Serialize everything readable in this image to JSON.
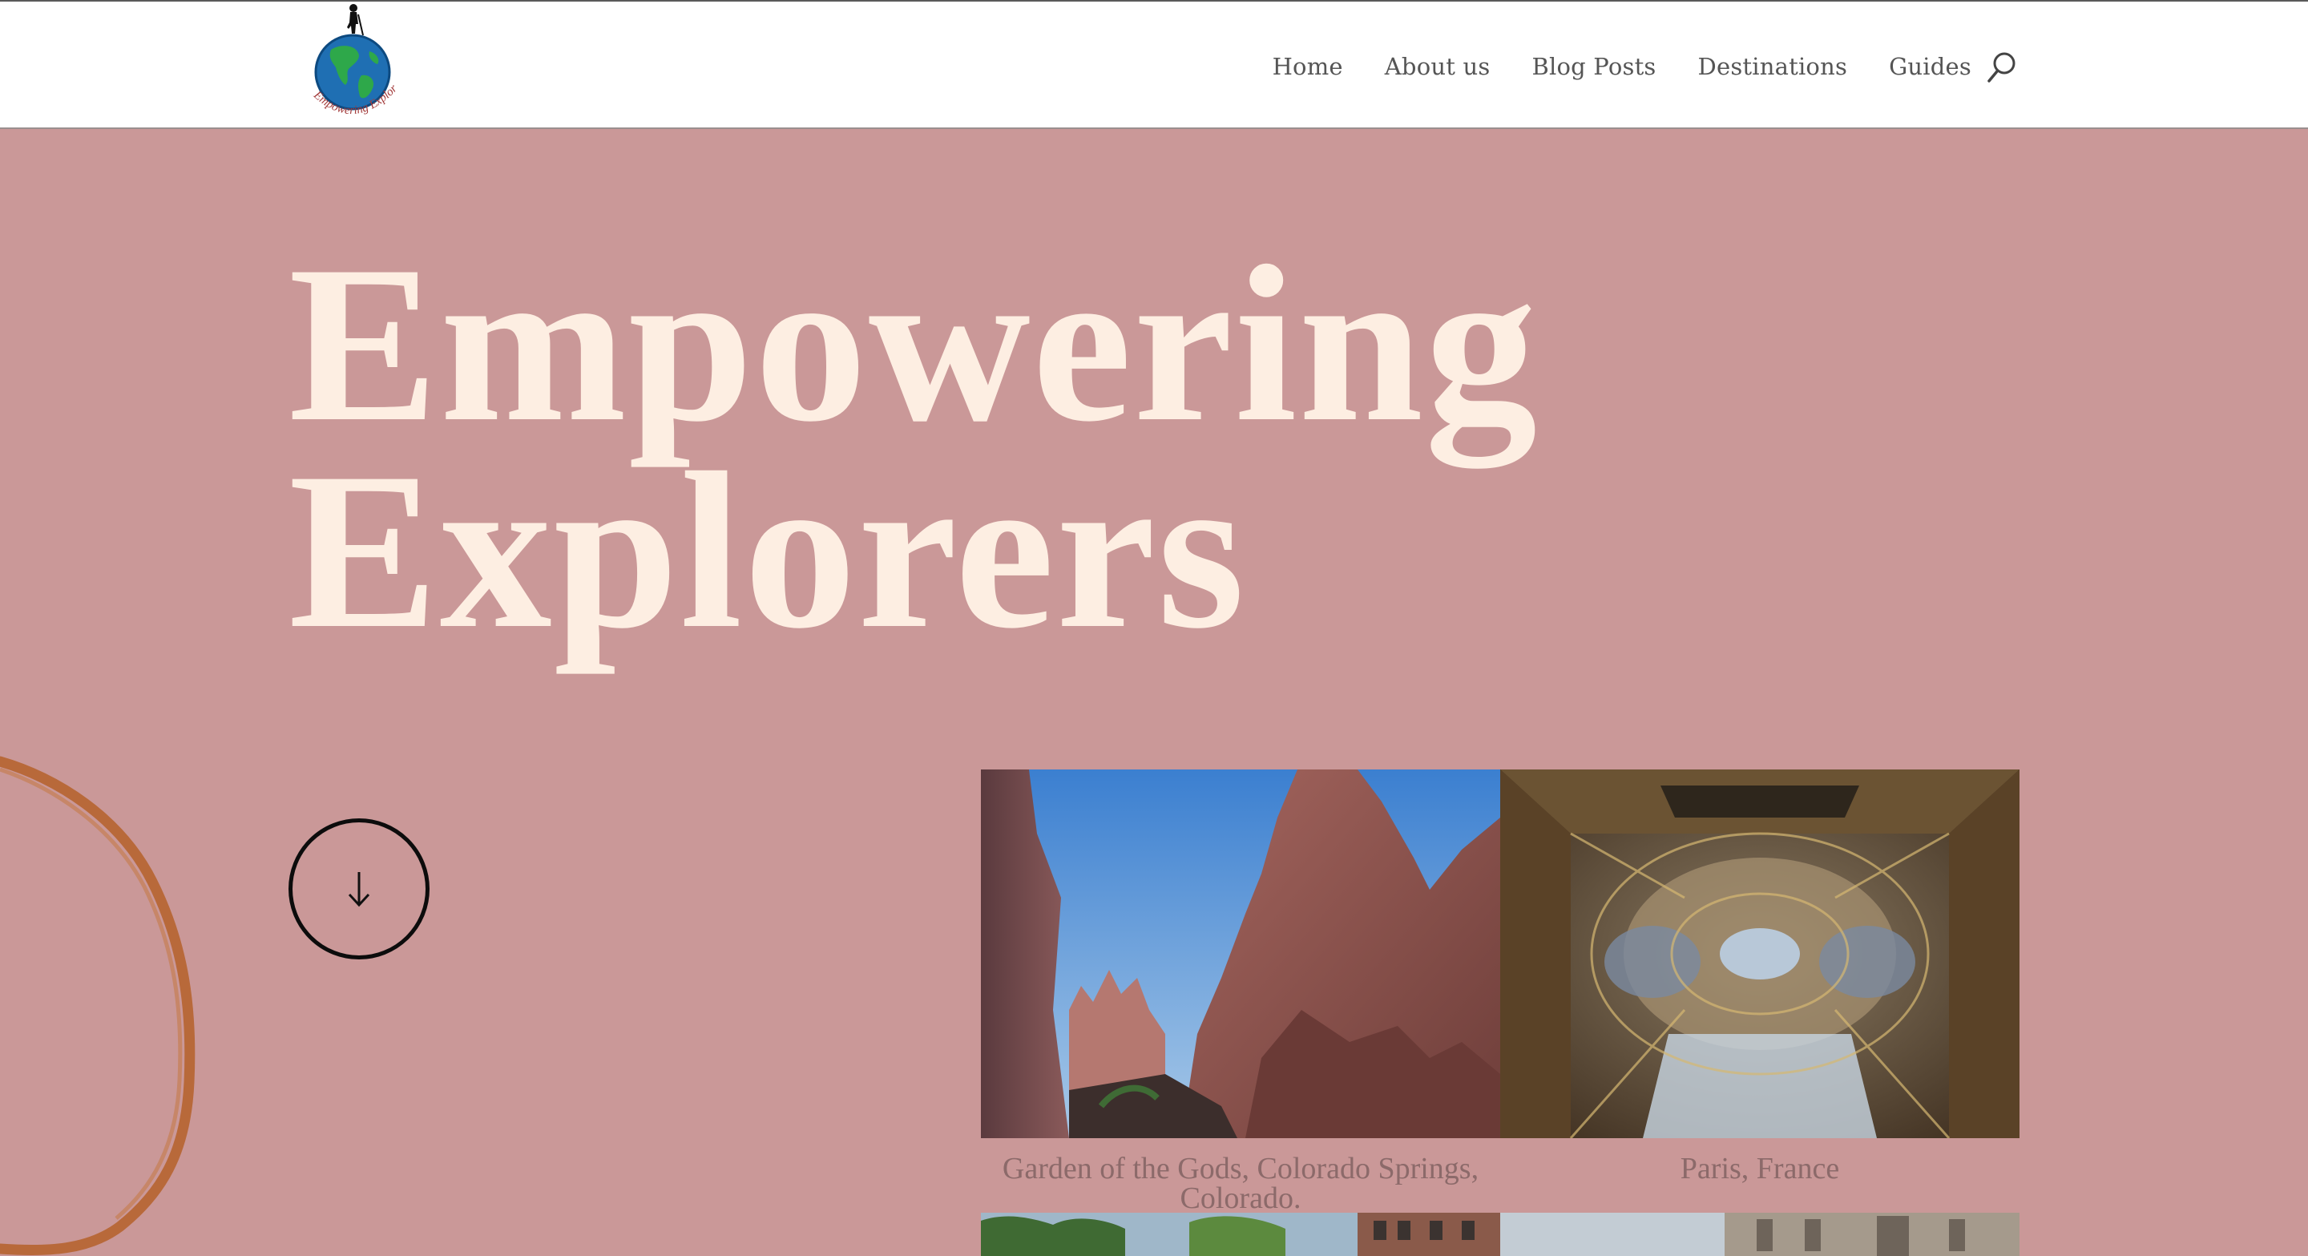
{
  "header": {
    "logo_text": "Empowering Explorers",
    "nav": {
      "home": "Home",
      "about": "About us",
      "blog": "Blog Posts",
      "destinations": "Destinations",
      "guides": "Guides"
    },
    "search_icon": "search-icon"
  },
  "hero": {
    "title_line1": "Empowering",
    "title_line2": "Explorers",
    "scroll_icon": "arrow-down-icon"
  },
  "gallery": [
    {
      "caption": "Garden of the Gods, Colorado Springs, Colorado."
    },
    {
      "caption": "Paris, France"
    }
  ],
  "colors": {
    "background": "#ca9898",
    "title": "#fdeee2",
    "accent_swoosh": "#b8693a",
    "caption": "#8c6a6a"
  }
}
